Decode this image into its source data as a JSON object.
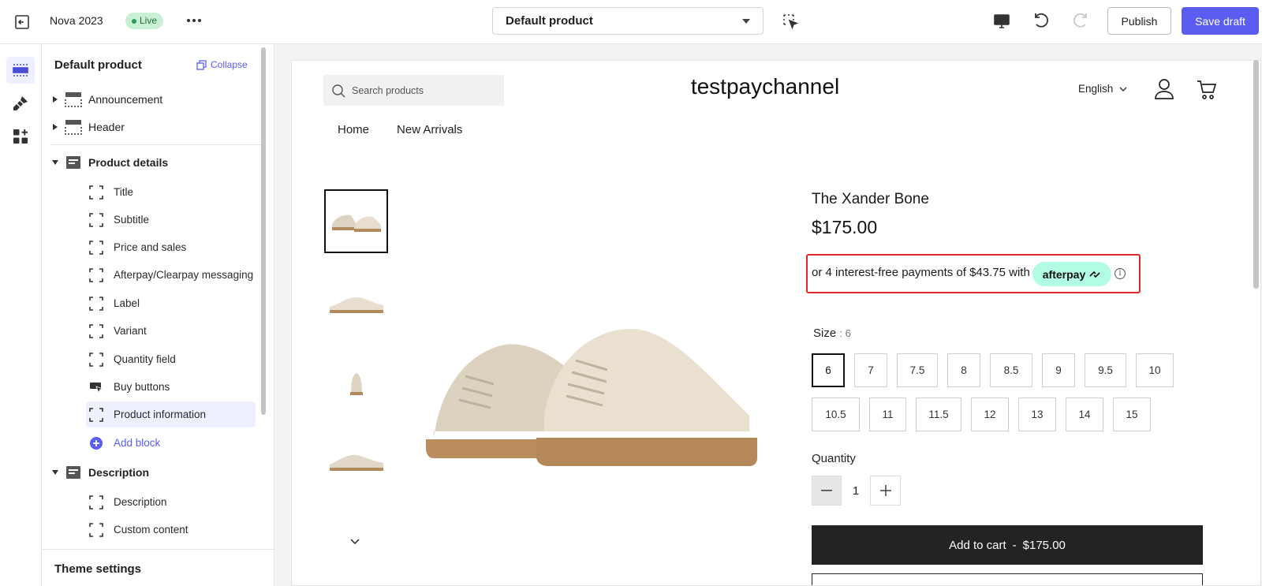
{
  "topbar": {
    "theme_name": "Nova 2023",
    "status_badge": "Live",
    "template_select": "Default product",
    "publish_label": "Publish",
    "save_label": "Save draft"
  },
  "sidebar": {
    "title": "Default product",
    "collapse_label": "Collapse",
    "sections": [
      {
        "label": "Announcement"
      },
      {
        "label": "Header"
      },
      {
        "label": "Product details"
      },
      {
        "label": "Description"
      }
    ],
    "product_blocks": [
      {
        "label": "Title"
      },
      {
        "label": "Subtitle"
      },
      {
        "label": "Price and sales"
      },
      {
        "label": "Afterpay/Clearpay messaging"
      },
      {
        "label": "Label"
      },
      {
        "label": "Variant"
      },
      {
        "label": "Quantity field"
      },
      {
        "label": "Buy buttons"
      },
      {
        "label": "Product information"
      }
    ],
    "add_block_label": "Add block",
    "description_blocks": [
      {
        "label": "Description"
      },
      {
        "label": "Custom content"
      }
    ],
    "footer_label": "Theme settings"
  },
  "storefront": {
    "search_placeholder": "Search products",
    "brand": "testpaychannel",
    "language": "English",
    "nav": [
      "Home",
      "New Arrivals"
    ]
  },
  "product": {
    "title": "The Xander Bone",
    "price": "$175.00",
    "afterpay_text": "or 4 interest-free payments of $43.75 with",
    "afterpay_brand": "afterpay",
    "afterpay_info": "i",
    "size_label": "Size",
    "size_current": ": 6",
    "sizes_row1": [
      "6",
      "7",
      "7.5",
      "8",
      "8.5",
      "9",
      "9.5",
      "10"
    ],
    "sizes_row2": [
      "10.5",
      "11",
      "11.5",
      "12",
      "13",
      "14",
      "15"
    ],
    "selected_size": "6",
    "quantity_label": "Quantity",
    "quantity_value": "1",
    "add_to_cart": "Add to cart",
    "add_to_cart_sep": "-",
    "add_to_cart_price": "$175.00"
  },
  "colors": {
    "accent": "#5b5cf0",
    "live": "#c9efd5",
    "afterpay": "#b2fce4",
    "highlight": "#e12727"
  }
}
